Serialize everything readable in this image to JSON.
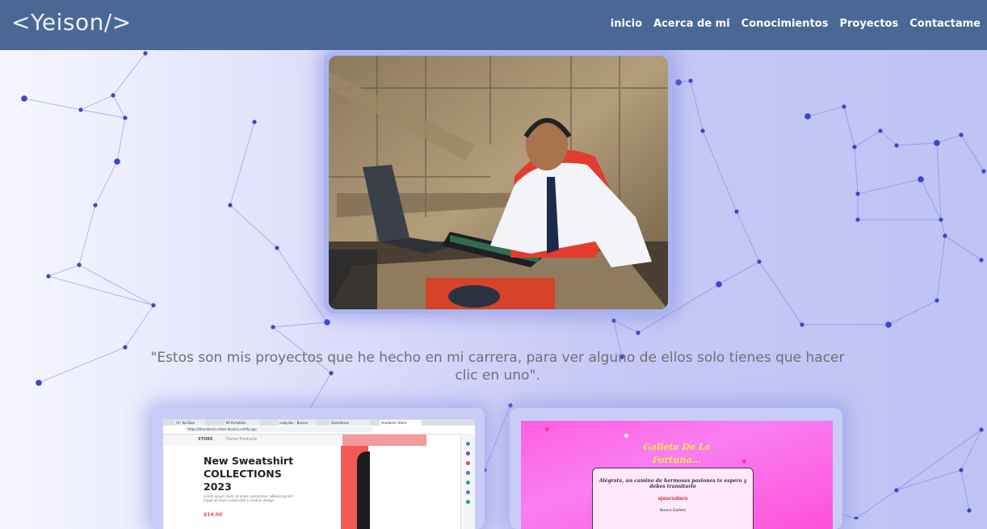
{
  "header": {
    "logo": "<Yeison/>",
    "nav": [
      "inicio",
      "Acerca de mi",
      "Conocimientos",
      "Proyectos",
      "Contactame"
    ]
  },
  "intro_text": "\"Estos son mis proyectos que he hecho en mi carrera, para ver alguno de ellos solo tienes que hacer clic en uno\".",
  "projects": [
    {
      "tabs": [
        "(1) YouTube",
        "Mi Portafolio",
        "cody.dev - Buscar",
        "Storeliness",
        "Academic Store"
      ],
      "url": "https://thundercia-retter-tbssica.netlify.app",
      "store_brand": "STORE",
      "store_nav": "Home   Products",
      "hero_title": [
        "New Sweatshirt",
        "COLLECTIONS",
        "2023"
      ],
      "hero_text": "Lorem ipsum dolor sit amet consectetur adipisicing elit fugiat ad illum soluta with a random design",
      "price": "$14.00"
    },
    {
      "title_lines": [
        "Galleta De La",
        "Fortuna..."
      ],
      "message": "Alégrate, un camino de hermosas pasiones te espera y debes transitarlo",
      "user": "ajescudero",
      "sign": "Nueva Galleta"
    }
  ],
  "colors": {
    "header_bg": "#4a6896",
    "accent_network": "#4b4fd6",
    "intro_text": "#6f6f7a"
  }
}
